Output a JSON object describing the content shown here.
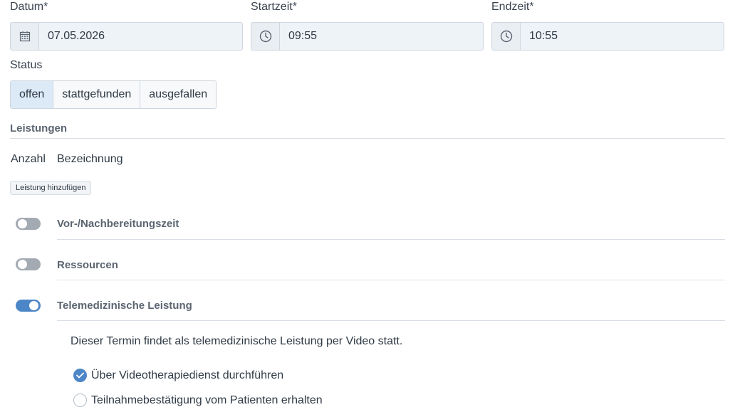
{
  "fields": {
    "datum": {
      "label": "Datum*",
      "value": "07.05.2026",
      "icon": "calendar-icon"
    },
    "startzeit": {
      "label": "Startzeit*",
      "value": "09:55",
      "icon": "clock-icon"
    },
    "endzeit": {
      "label": "Endzeit*",
      "value": "10:55",
      "icon": "clock-icon"
    }
  },
  "status": {
    "label": "Status",
    "options": [
      "offen",
      "stattgefunden",
      "ausgefallen"
    ],
    "selected": "offen"
  },
  "leistungen": {
    "heading": "Leistungen",
    "columns": [
      "Anzahl",
      "Bezeichnung"
    ],
    "add_button": "Leistung hinzufügen"
  },
  "toggles": [
    {
      "label": "Vor-/Nachbereitungszeit",
      "on": false
    },
    {
      "label": "Ressourcen",
      "on": false
    },
    {
      "label": "Telemedizinische Leistung",
      "on": true
    }
  ],
  "telemedizin": {
    "description": "Dieser Termin findet als telemedizinische Leistung per Video statt.",
    "options": [
      {
        "label": "Über Videotherapiedienst durchführen",
        "checked": true
      },
      {
        "label": "Teilnahmebestätigung vom Patienten erhalten",
        "checked": false
      }
    ]
  },
  "colors": {
    "accent": "#4c86c6",
    "toggle_off": "#a3aab2",
    "field_bg": "#eef3f8",
    "segment_active": "#dce9f6"
  }
}
